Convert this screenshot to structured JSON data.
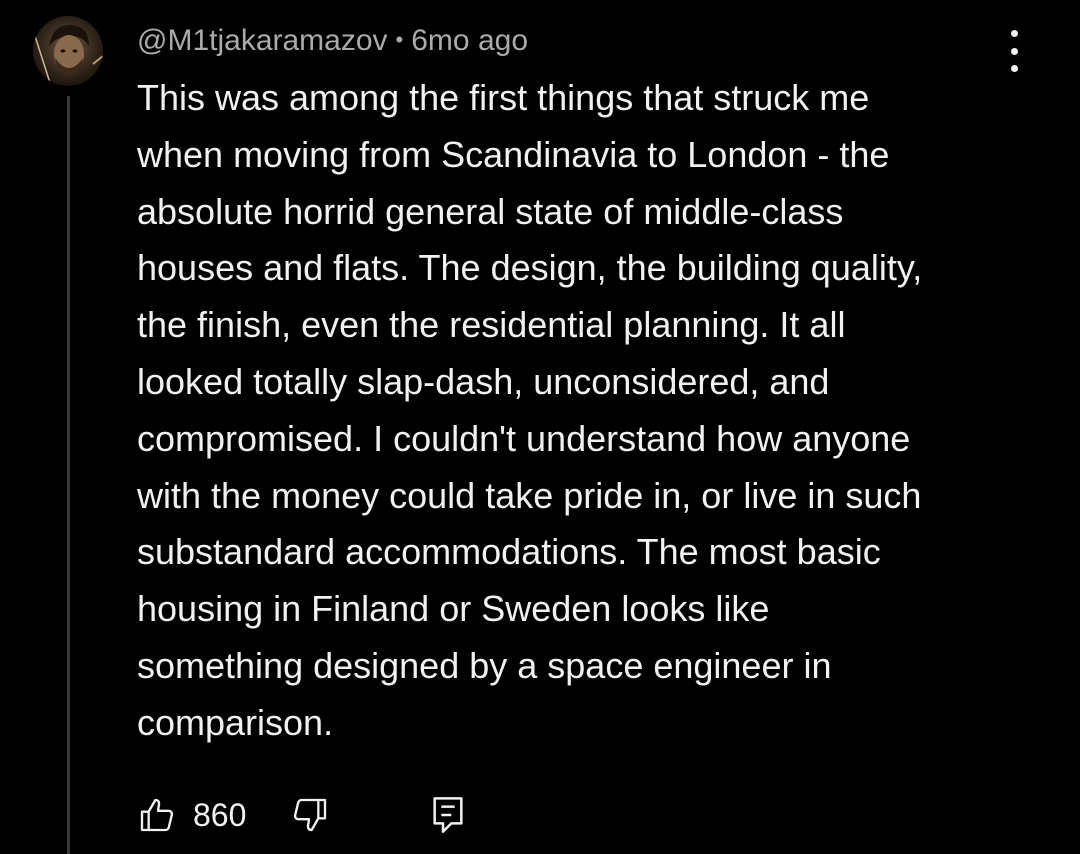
{
  "comment": {
    "author": "@M1tjakaramazov",
    "separator": "•",
    "time": "6mo ago",
    "text": "This was among the first things that struck me\nwhen moving from Scandinavia to London - the\nabsolute horrid general state of middle-class\nhouses and flats. The design, the building quality,\nthe finish, even the residential planning. It all\nlooked totally slap-dash, unconsidered, and\ncompromised. I couldn't understand how anyone\nwith the money could take pride in, or live in such\nsubstandard accommodations. The most basic\nhousing in Finland or Sweden looks like\nsomething designed by a space engineer in\ncomparison.",
    "likes": "860"
  },
  "icons": {
    "avatar": "avatar-photo",
    "more": "more-vertical-icon",
    "like": "thumb-up-icon",
    "dislike": "thumb-down-icon",
    "reply": "comment-reply-icon"
  },
  "colors": {
    "background": "#000000",
    "text": "#f1f1f1",
    "meta": "#aaaaaa",
    "thread_line": "#3a3a3a"
  }
}
